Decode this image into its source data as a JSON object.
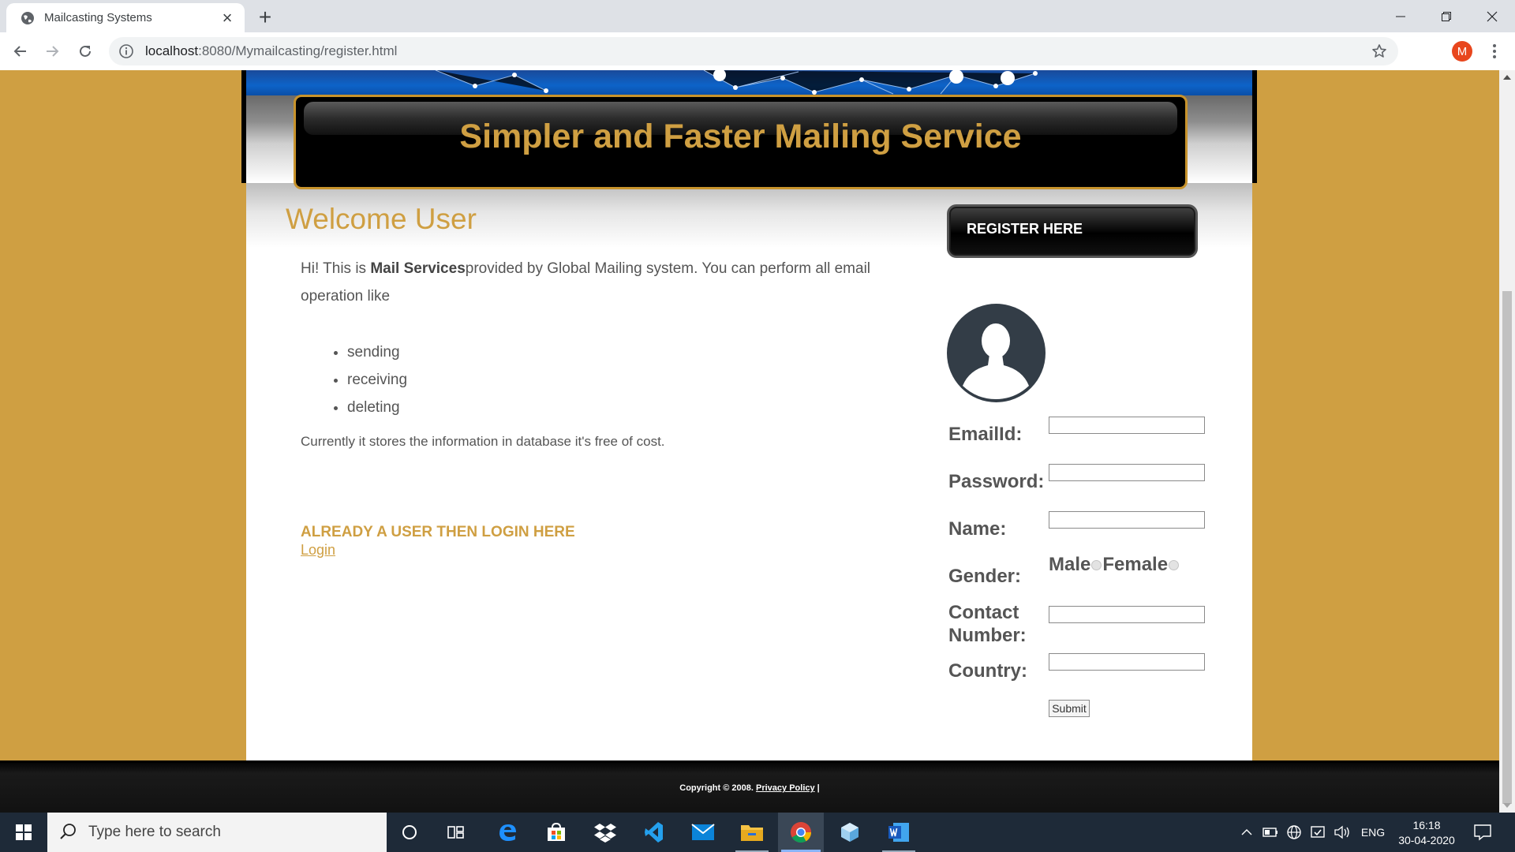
{
  "browser": {
    "tab_title": "Mailcasting Systems",
    "url_host": "localhost",
    "url_rest": ":8080/Mymailcasting/register.html",
    "profile_initial": "M"
  },
  "site": {
    "title": "Simpler and Faster Mailing Service",
    "accent_color": "#cf9f42"
  },
  "content": {
    "welcome": "Welcome User",
    "intro_prefix": "Hi! This is ",
    "intro_bold": "Mail Services",
    "intro_suffix": "provided by Global Mailing system. You can perform all email operation like",
    "features": [
      "sending",
      "receiving",
      "deleting"
    ],
    "note": "Currently it stores the information in database it's free of cost.",
    "already_user": "ALREADY A USER THEN LOGIN HERE",
    "login_link": "Login"
  },
  "register": {
    "button_label": "REGISTER HERE",
    "fields": {
      "email_label": "EmailId:",
      "password_label": "Password:",
      "name_label": "Name:",
      "gender_label": "Gender:",
      "contact_label_1": "Contact",
      "contact_label_2": "Number:",
      "country_label": "Country:"
    },
    "gender_options": [
      "Male",
      "Female"
    ],
    "submit_label": "Submit"
  },
  "footer": {
    "copyright": "Copyright © 2008. ",
    "privacy_link": "Privacy Policy",
    "separator": " |"
  },
  "taskbar": {
    "search_placeholder": "Type here to search",
    "language": "ENG",
    "time": "16:18",
    "date": "30-04-2020"
  }
}
